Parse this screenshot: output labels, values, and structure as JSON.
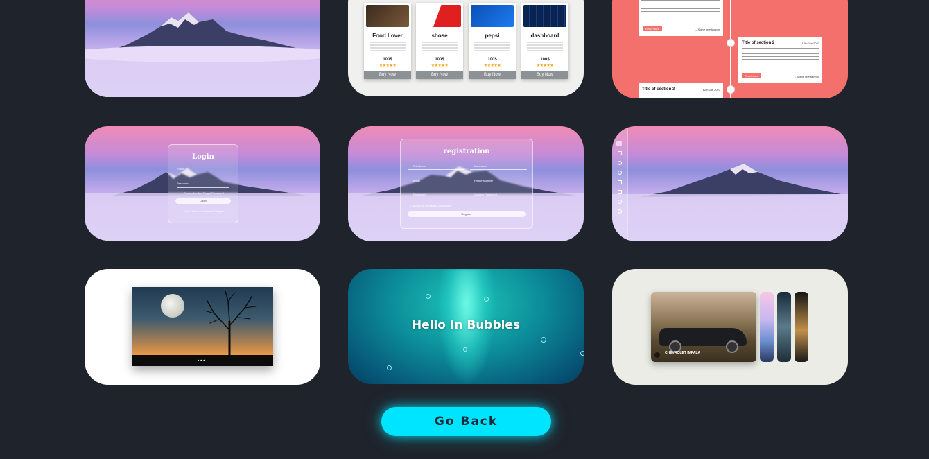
{
  "cards": {
    "shop": {
      "products": [
        {
          "name": "Food Lover",
          "price": "100$",
          "stars": "★★★★★",
          "button": "Buy Now"
        },
        {
          "name": "shose",
          "price": "100$",
          "stars": "★★★★★",
          "button": "Buy Now"
        },
        {
          "name": "pepsi",
          "price": "100$",
          "stars": "★★★★★",
          "button": "Buy Now"
        },
        {
          "name": "dashboard",
          "price": "100$",
          "stars": "★★★★★",
          "button": "Buy Now"
        }
      ]
    },
    "timeline": {
      "section2_title": "Title of section 2",
      "section2_date": "12th Jan 2023",
      "section3_title": "Title of section 3",
      "section3_date": "12th Jan 2023",
      "read_more": "Read more",
      "author": "– Some one famous"
    },
    "login": {
      "title": "Login",
      "email_label": "Email",
      "password_label": "Password",
      "remember": "Remember Me  Forget Password",
      "button": "Login",
      "register_text": "Don't have an account? Register"
    },
    "registration": {
      "title": "registration",
      "field_1": "Full Name",
      "field_2": "Username",
      "field_3": "Email",
      "field_4": "Phone Number",
      "field_5": "Password",
      "field_6": "Confirm Password",
      "terms": "I accept the terms and conditions",
      "button": "Register"
    },
    "bubbles": {
      "text": "Hello In Bubbles"
    },
    "carousel": {
      "caption_title": "CHEVROLET IMPALA",
      "colors": {
        "bg": "#ecece6"
      }
    }
  },
  "go_back": "Go Back",
  "colors": {
    "page_bg": "#1f232b",
    "accent": "#00e5ff",
    "timeline_bg": "#f4706d"
  }
}
